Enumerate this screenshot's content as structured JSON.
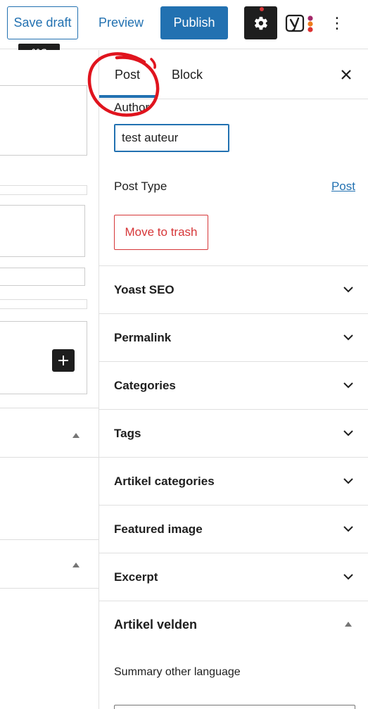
{
  "toolbar": {
    "save_draft": "Save draft",
    "preview": "Preview",
    "publish": "Publish",
    "settings_icon": "gear-icon",
    "yoast_icon": "yoast-icon",
    "more_icon": "more-vertical-icon",
    "more_glyph": "⋮",
    "shortcut_tooltip": "⌘S"
  },
  "sidebar": {
    "tabs": [
      {
        "label": "Post",
        "active": true
      },
      {
        "label": "Block",
        "active": false
      }
    ],
    "close_icon": "close-icon",
    "author": {
      "label": "Author",
      "value": "test auteur"
    },
    "post_type": {
      "label": "Post Type",
      "value": "Post"
    },
    "trash_button": "Move to trash",
    "panels": [
      {
        "title": "Yoast SEO",
        "open": false
      },
      {
        "title": "Permalink",
        "open": false
      },
      {
        "title": "Categories",
        "open": false
      },
      {
        "title": "Tags",
        "open": false
      },
      {
        "title": "Artikel categories",
        "open": false
      },
      {
        "title": "Featured image",
        "open": false
      },
      {
        "title": "Excerpt",
        "open": false
      },
      {
        "title": "Artikel velden",
        "open": true
      }
    ],
    "artikel_velden": {
      "summary_label": "Summary other language",
      "summary_value": ""
    }
  },
  "editor": {
    "add_block_icon": "plus-icon"
  },
  "colors": {
    "accent": "#2271b1",
    "danger": "#d63638",
    "annotation": "#e0141e",
    "dark": "#1e1e1e"
  }
}
